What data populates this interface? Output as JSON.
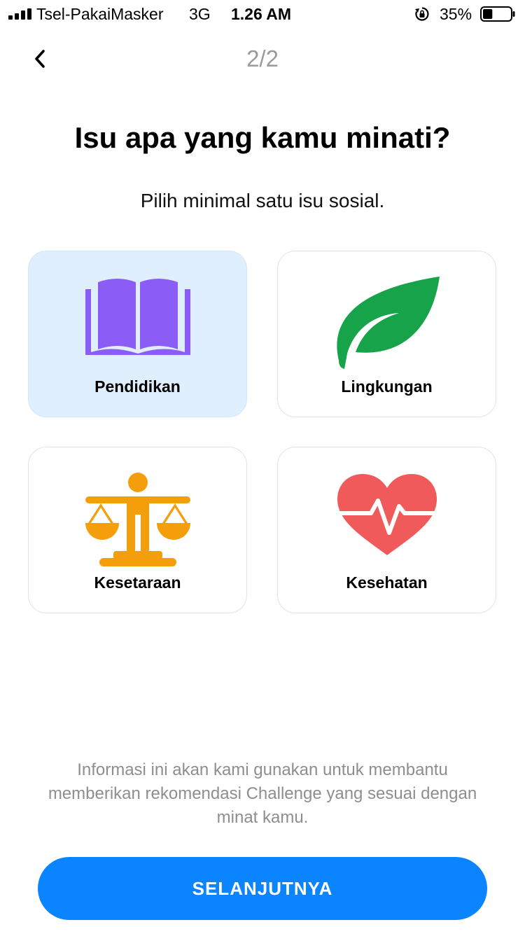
{
  "status_bar": {
    "carrier": "Tsel-PakaiMasker",
    "network": "3G",
    "time": "1.26 AM",
    "battery_percent": "35%",
    "battery_level": 0.35,
    "signal_icon": "signal-bars-icon",
    "rotation_icon": "rotation-lock-icon",
    "battery_icon": "battery-icon"
  },
  "header": {
    "back_icon": "chevron-left-icon",
    "step": "2/2"
  },
  "title": "Isu apa yang kamu minati?",
  "subtitle": "Pilih minimal satu isu sosial.",
  "issues": [
    {
      "label": "Pendidikan",
      "icon": "book-icon",
      "selected": true,
      "color": "#8b5cf6"
    },
    {
      "label": "Lingkungan",
      "icon": "leaf-icon",
      "selected": false,
      "color": "#16a34a"
    },
    {
      "label": "Kesetaraan",
      "icon": "scales-icon",
      "selected": false,
      "color": "#f59e0b"
    },
    {
      "label": "Kesehatan",
      "icon": "heart-pulse-icon",
      "selected": false,
      "color": "#f05a5a"
    }
  ],
  "info_text": "Informasi ini akan kami gunakan untuk membantu memberikan rekomendasi Challenge yang sesuai dengan minat kamu.",
  "cta_label": "SELANJUTNYA",
  "colors": {
    "accent": "#0a84ff",
    "selected_card_bg": "#e0effd"
  }
}
